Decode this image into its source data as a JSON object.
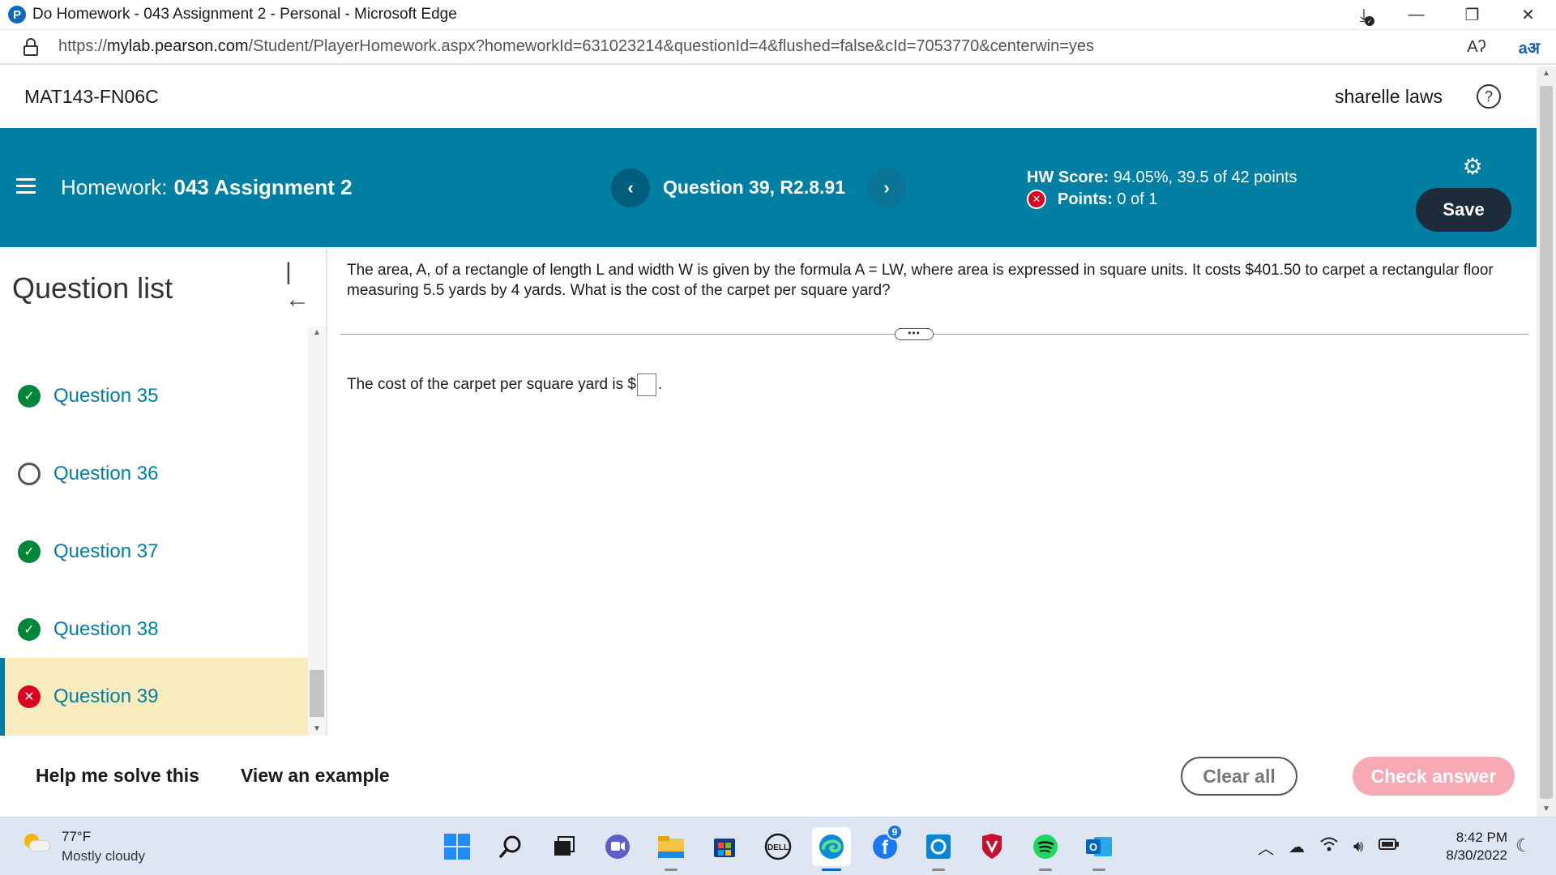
{
  "browser": {
    "title": "Do Homework - 043 Assignment 2 - Personal - Microsoft Edge",
    "url_prefix": "https://",
    "url_host": "mylab.pearson.com",
    "url_path": "/Student/PlayerHomework.aspx?homeworkId=631023214&questionId=4&flushed=false&cId=7053770&centerwin=yes",
    "read_aloud_glyph": "Aʔ",
    "translate_glyph": "aअ",
    "minimize_glyph": "—",
    "restore_glyph": "❐",
    "close_glyph": "✕",
    "download_glyph": "⤓"
  },
  "course": {
    "code": "MAT143-FN06C",
    "user": "sharelle laws",
    "help_glyph": "?"
  },
  "homework": {
    "label": "Homework:",
    "name": "043 Assignment 2",
    "question_title": "Question 39, R2.8.91",
    "prev_glyph": "‹",
    "next_glyph": "›",
    "score_label": "HW Score:",
    "score_value": "94.05%, 39.5 of 42 points",
    "points_label": "Points:",
    "points_value": "0 of 1",
    "save_label": "Save",
    "gear_glyph": "⚙"
  },
  "question_list": {
    "title": "Question list",
    "collapse_glyph": "|←",
    "items": [
      {
        "label": "Question 35",
        "status": "correct"
      },
      {
        "label": "Question 36",
        "status": "unanswered"
      },
      {
        "label": "Question 37",
        "status": "correct"
      },
      {
        "label": "Question 38",
        "status": "correct"
      },
      {
        "label": "Question 39",
        "status": "incorrect",
        "active": true
      }
    ]
  },
  "question": {
    "stem": "The area, A, of a rectangle of length L and width W is given by the formula A = LW, where area is expressed in square units. It costs $401.50 to carpet a rectangular floor measuring 5.5 yards by 4 yards. What is the cost of the carpet per square yard?",
    "answer_prefix": "The cost of the carpet per square yard is $",
    "answer_value": "",
    "answer_suffix": ".",
    "expand_glyph": "•••"
  },
  "actions": {
    "help_solve": "Help me solve this",
    "view_example": "View an example",
    "clear_all": "Clear all",
    "check_answer": "Check answer"
  },
  "taskbar": {
    "temperature": "77°F",
    "condition": "Mostly cloudy",
    "time": "8:42 PM",
    "date": "8/30/2022",
    "mail_badge": "9"
  },
  "colors": {
    "teal": "#007fa3",
    "save_bg": "#1d2b3a",
    "correct": "#008638",
    "incorrect": "#db0020",
    "active_row": "#f8ecbe",
    "check_answer_bg": "#f7a9b4"
  }
}
